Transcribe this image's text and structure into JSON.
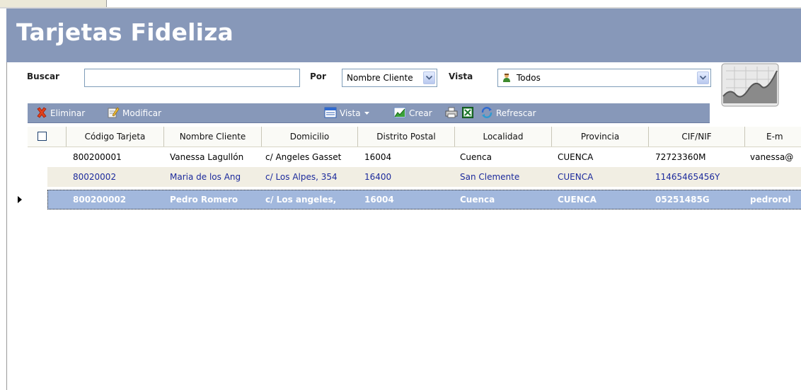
{
  "header": {
    "title": "Tarjetas Fideliza"
  },
  "search": {
    "buscar_label": "Buscar",
    "buscar_value": "",
    "por_label": "Por",
    "por_value": "Nombre Cliente",
    "vista_label": "Vista",
    "vista_value": "Todos"
  },
  "toolbar": {
    "eliminar": "Eliminar",
    "modificar": "Modificar",
    "vista": "Vista",
    "crear": "Crear",
    "refrescar": "Refrescar"
  },
  "grid": {
    "columns": [
      "Código Tarjeta",
      "Nombre Cliente",
      "Domicilio",
      "Distrito Postal",
      "Localidad",
      "Provincia",
      "CIF/NIF",
      "E-m"
    ],
    "rows": [
      [
        "800200001",
        "Vanessa Lagullón",
        "c/ Angeles Gasset",
        "16004",
        "Cuenca",
        "CUENCA",
        "72723360M",
        "vanessa@"
      ],
      [
        "80020002",
        "Maria de los Ang",
        "c/ Los Alpes, 354",
        "16400",
        "San Clemente",
        "CUENCA",
        "11465465456Y",
        ""
      ],
      [
        "800200002",
        "Pedro Romero",
        "c/ Los angeles,",
        "16004",
        "Cuenca",
        "CUENCA",
        "05251485G",
        "pedrorol"
      ]
    ]
  },
  "colors": {
    "header_bg": "#8798b9",
    "selected_row_bg": "#a2b8dd",
    "alt_row_bg": "#f1eee3",
    "alt_row_text": "#1c2a9c"
  },
  "icons": [
    "delete-icon",
    "edit-icon",
    "view-icon",
    "create-chart-icon",
    "print-icon",
    "excel-icon",
    "refresh-icon",
    "user-icon",
    "chart-icon",
    "dropdown-arrow-icon",
    "row-pointer-icon"
  ]
}
